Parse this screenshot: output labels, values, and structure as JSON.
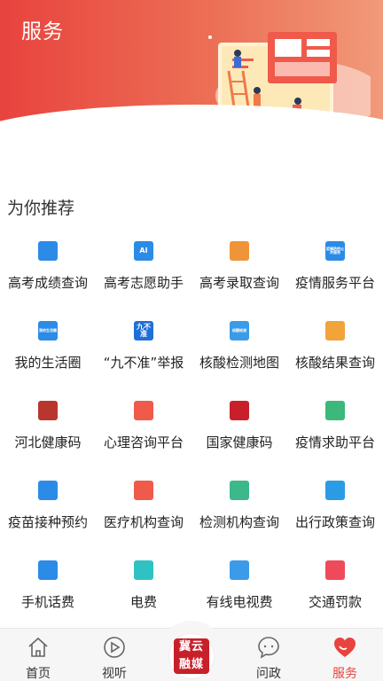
{
  "header": {
    "title": "服务"
  },
  "section": {
    "title": "为你推荐"
  },
  "services": [
    {
      "label": "高考成绩查询",
      "icon": "exam-score-icon",
      "icon_text": "",
      "color": "#2b8be6"
    },
    {
      "label": "高考志愿助手",
      "icon": "graduation-cap-icon",
      "icon_text": "AI",
      "color": "#2b8be6"
    },
    {
      "label": "高考录取查询",
      "icon": "open-book-icon",
      "icon_text": "",
      "color": "#f0943a"
    },
    {
      "label": "疫情服务平台",
      "icon": "epidemic-service-icon",
      "icon_text": "疫情防控公共服务",
      "color": "#2b8be6"
    },
    {
      "label": "我的生活圈",
      "icon": "life-circle-icon",
      "icon_text": "我的生活圈",
      "color": "#2b8be6"
    },
    {
      "label": "“九不准”举报",
      "icon": "report-icon",
      "icon_text": "九不准",
      "color": "#1f6fd6"
    },
    {
      "label": "核酸检测地图",
      "icon": "test-map-icon",
      "icon_text": "核酸检测",
      "color": "#3b9be8"
    },
    {
      "label": "核酸结果查询",
      "icon": "test-result-icon",
      "icon_text": "",
      "color": "#f0a43a"
    },
    {
      "label": "河北健康码",
      "icon": "hebei-emblem-icon",
      "icon_text": "",
      "color": "#b8362e"
    },
    {
      "label": "心理咨询平台",
      "icon": "heart-chat-icon",
      "icon_text": "",
      "color": "#ef5a4a"
    },
    {
      "label": "国家健康码",
      "icon": "national-emblem-icon",
      "icon_text": "",
      "color": "#c8202a"
    },
    {
      "label": "疫情求助平台",
      "icon": "handshake-icon",
      "icon_text": "",
      "color": "#3cb87a"
    },
    {
      "label": "疫苗接种预约",
      "icon": "vaccine-icon",
      "icon_text": "",
      "color": "#2b8be6"
    },
    {
      "label": "医疗机构查询",
      "icon": "medical-cross-icon",
      "icon_text": "",
      "color": "#ef5a4a"
    },
    {
      "label": "检测机构查询",
      "icon": "location-pin-icon",
      "icon_text": "",
      "color": "#3cb88a"
    },
    {
      "label": "出行政策查询",
      "icon": "document-icon",
      "icon_text": "",
      "color": "#2b9be6"
    },
    {
      "label": "手机话费",
      "icon": "phone-bill-icon",
      "icon_text": "",
      "color": "#2b8be6"
    },
    {
      "label": "电费",
      "icon": "lightning-icon",
      "icon_text": "",
      "color": "#2ec2c2"
    },
    {
      "label": "有线电视费",
      "icon": "tv-icon",
      "icon_text": "",
      "color": "#3b9be8"
    },
    {
      "label": "交通罚款",
      "icon": "traffic-fine-icon",
      "icon_text": "",
      "color": "#ef4a5a"
    }
  ],
  "tabbar": {
    "tabs": [
      {
        "label": "首页",
        "icon": "home-icon"
      },
      {
        "label": "视听",
        "icon": "play-icon"
      },
      {
        "label": "问政",
        "icon": "chat-bubble-icon"
      },
      {
        "label": "服务",
        "icon": "heart-icon",
        "active": true
      }
    ],
    "center_logo_text": "冀云融媒"
  },
  "colors": {
    "accent": "#e8433e",
    "tab_active": "#e8433e",
    "tab_inactive": "#666666"
  }
}
